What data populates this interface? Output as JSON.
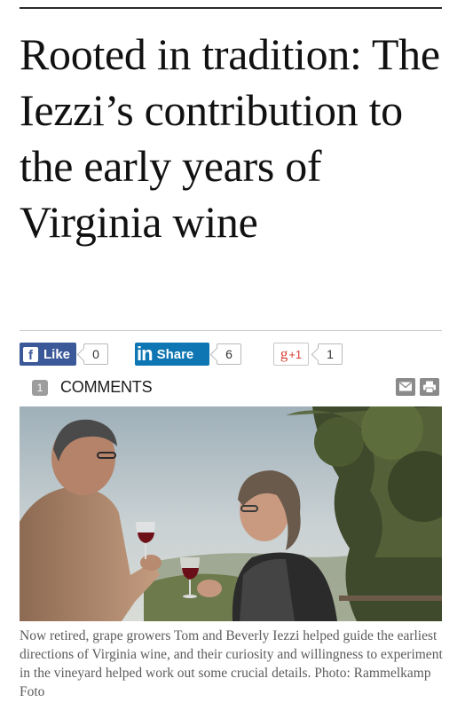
{
  "article": {
    "headline": "Rooted in tradition: The Iezzi’s contribution to the early years of Virginia wine",
    "caption": "Now retired, grape growers Tom and Beverly Iezzi helped guide the earliest directions of Virginia wine, and their curiosity and willingness to experiment in the vineyard helped work out some crucial details. Photo: Rammelkamp Foto"
  },
  "social": {
    "facebook": {
      "icon_letter": "f",
      "label": "Like",
      "count": "0",
      "color": "#3b5998"
    },
    "linkedin": {
      "icon_text": "in",
      "label": "Share",
      "count": "6",
      "color": "#0e76b3"
    },
    "googleplus": {
      "label": "g",
      "plus": "+1",
      "count": "1",
      "color": "#d73d32"
    }
  },
  "comments": {
    "count": "1",
    "label": "COMMENTS"
  },
  "tools": {
    "email_icon": "envelope-icon",
    "print_icon": "printer-icon"
  },
  "photo": {
    "subject": "photo-of-couple-toasting-with-red-wine"
  }
}
